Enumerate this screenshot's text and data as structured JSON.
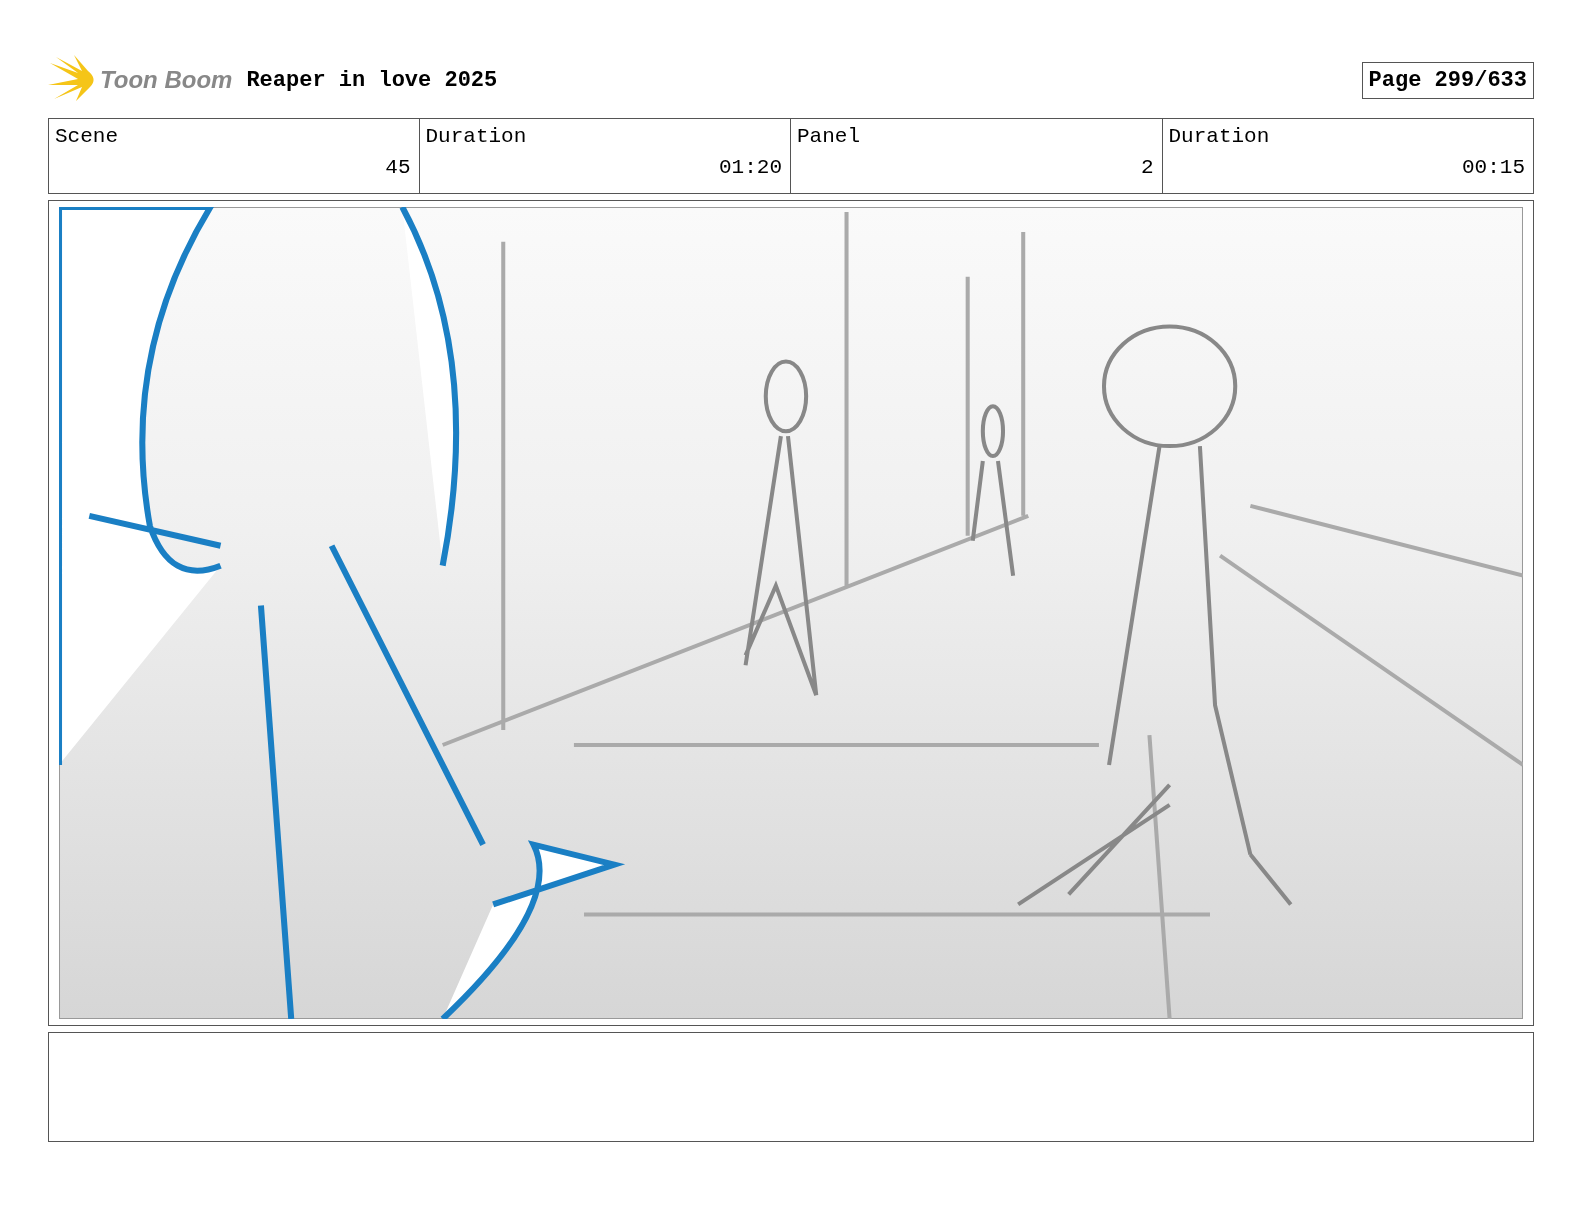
{
  "header": {
    "logo_text": "Toon Boom",
    "title": "Reaper in love 2025",
    "page": "Page 299/633"
  },
  "info_table": {
    "columns": [
      "Scene",
      "Duration",
      "Panel",
      "Duration"
    ],
    "row": [
      "45",
      "01:20",
      "2",
      "00:15"
    ]
  }
}
